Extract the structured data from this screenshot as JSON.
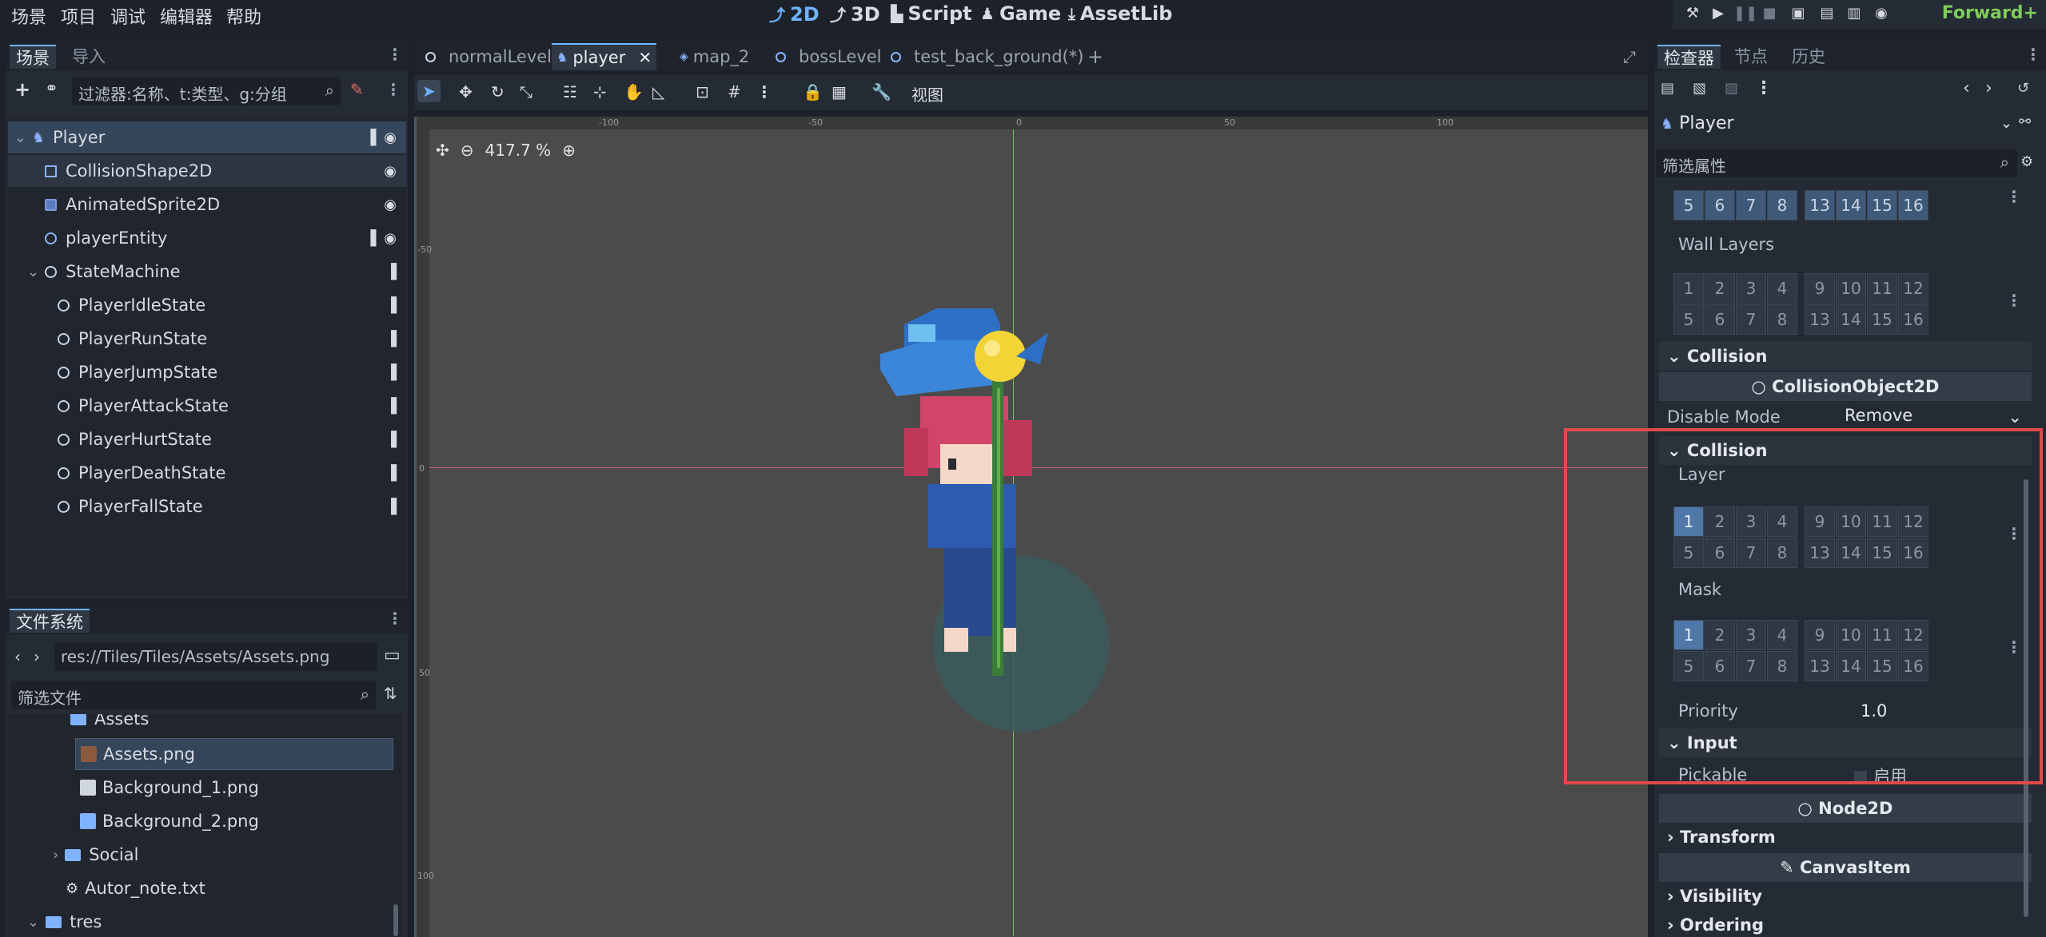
{
  "menu": [
    "场景",
    "项目",
    "调试",
    "编辑器",
    "帮助"
  ],
  "workspaces": [
    {
      "label": "2D",
      "icon": "2d-icon",
      "active": true
    },
    {
      "label": "3D",
      "icon": "3d-icon",
      "active": false
    },
    {
      "label": "Script",
      "icon": "script-icon",
      "active": false
    },
    {
      "label": "Game",
      "icon": "game-icon",
      "active": false
    },
    {
      "label": "AssetLib",
      "icon": "assetlib-icon",
      "active": false
    }
  ],
  "renderer": "Forward+",
  "scene_panel": {
    "tabs": [
      "场景",
      "导入"
    ],
    "filter_placeholder": "过滤器:名称、t:类型、g:分组",
    "tree": [
      {
        "label": "Player",
        "indent": 0
      },
      {
        "label": "CollisionShape2D",
        "indent": 1
      },
      {
        "label": "AnimatedSprite2D",
        "indent": 1
      },
      {
        "label": "playerEntity",
        "indent": 1
      },
      {
        "label": "StateMachine",
        "indent": 1
      },
      {
        "label": "PlayerIdleState",
        "indent": 2
      },
      {
        "label": "PlayerRunState",
        "indent": 2
      },
      {
        "label": "PlayerJumpState",
        "indent": 2
      },
      {
        "label": "PlayerAttackState",
        "indent": 2
      },
      {
        "label": "PlayerHurtState",
        "indent": 2
      },
      {
        "label": "PlayerDeathState",
        "indent": 2
      },
      {
        "label": "PlayerFallState",
        "indent": 2
      }
    ]
  },
  "filesystem": {
    "title": "文件系统",
    "path": "res://Tiles/Tiles/Assets/Assets.png",
    "filter_placeholder": "筛选文件",
    "items": [
      {
        "label": "Assets",
        "type": "folder"
      },
      {
        "label": "Assets.png",
        "type": "image"
      },
      {
        "label": "Background_1.png",
        "type": "image"
      },
      {
        "label": "Background_2.png",
        "type": "image"
      },
      {
        "label": "Social",
        "type": "folder"
      },
      {
        "label": "Autor_note.txt",
        "type": "text"
      },
      {
        "label": "tres",
        "type": "folder"
      }
    ]
  },
  "scene_tabs": [
    {
      "label": "normalLevel",
      "active": false
    },
    {
      "label": "player",
      "active": true
    },
    {
      "label": "map_2",
      "active": false
    },
    {
      "label": "bossLevel",
      "active": false
    },
    {
      "label": "test_back_ground(*)",
      "active": false
    }
  ],
  "viewport": {
    "view_menu": "视图",
    "zoom": "417.7 %",
    "ruler_top": [
      "-100",
      "-50",
      "0",
      "50",
      "100"
    ],
    "ruler_left": [
      "-50",
      "0",
      "50",
      "100"
    ]
  },
  "inspector": {
    "tabs": [
      "检查器",
      "节点",
      "历史"
    ],
    "object_name": "Player",
    "filter_placeholder": "筛选属性",
    "wall_layers_label": "Wall Layers",
    "collision_header_1": "Collision",
    "collision_object_class": "CollisionObject2D",
    "disable_mode_label": "Disable Mode",
    "disable_mode_value": "Remove",
    "collision_header_2": "Collision",
    "layer_label": "Layer",
    "mask_label": "Mask",
    "priority_label": "Priority",
    "priority_value": "1.0",
    "input_header": "Input",
    "pickable_label": "Pickable",
    "pickable_value": "启用",
    "node2d_class": "Node2D",
    "transform_header": "Transform",
    "canvasitem_class": "CanvasItem",
    "visibility_header": "Visibility",
    "ordering_header": "Ordering",
    "layer_bits_on": [
      1
    ],
    "mask_bits_on": [
      1
    ]
  }
}
